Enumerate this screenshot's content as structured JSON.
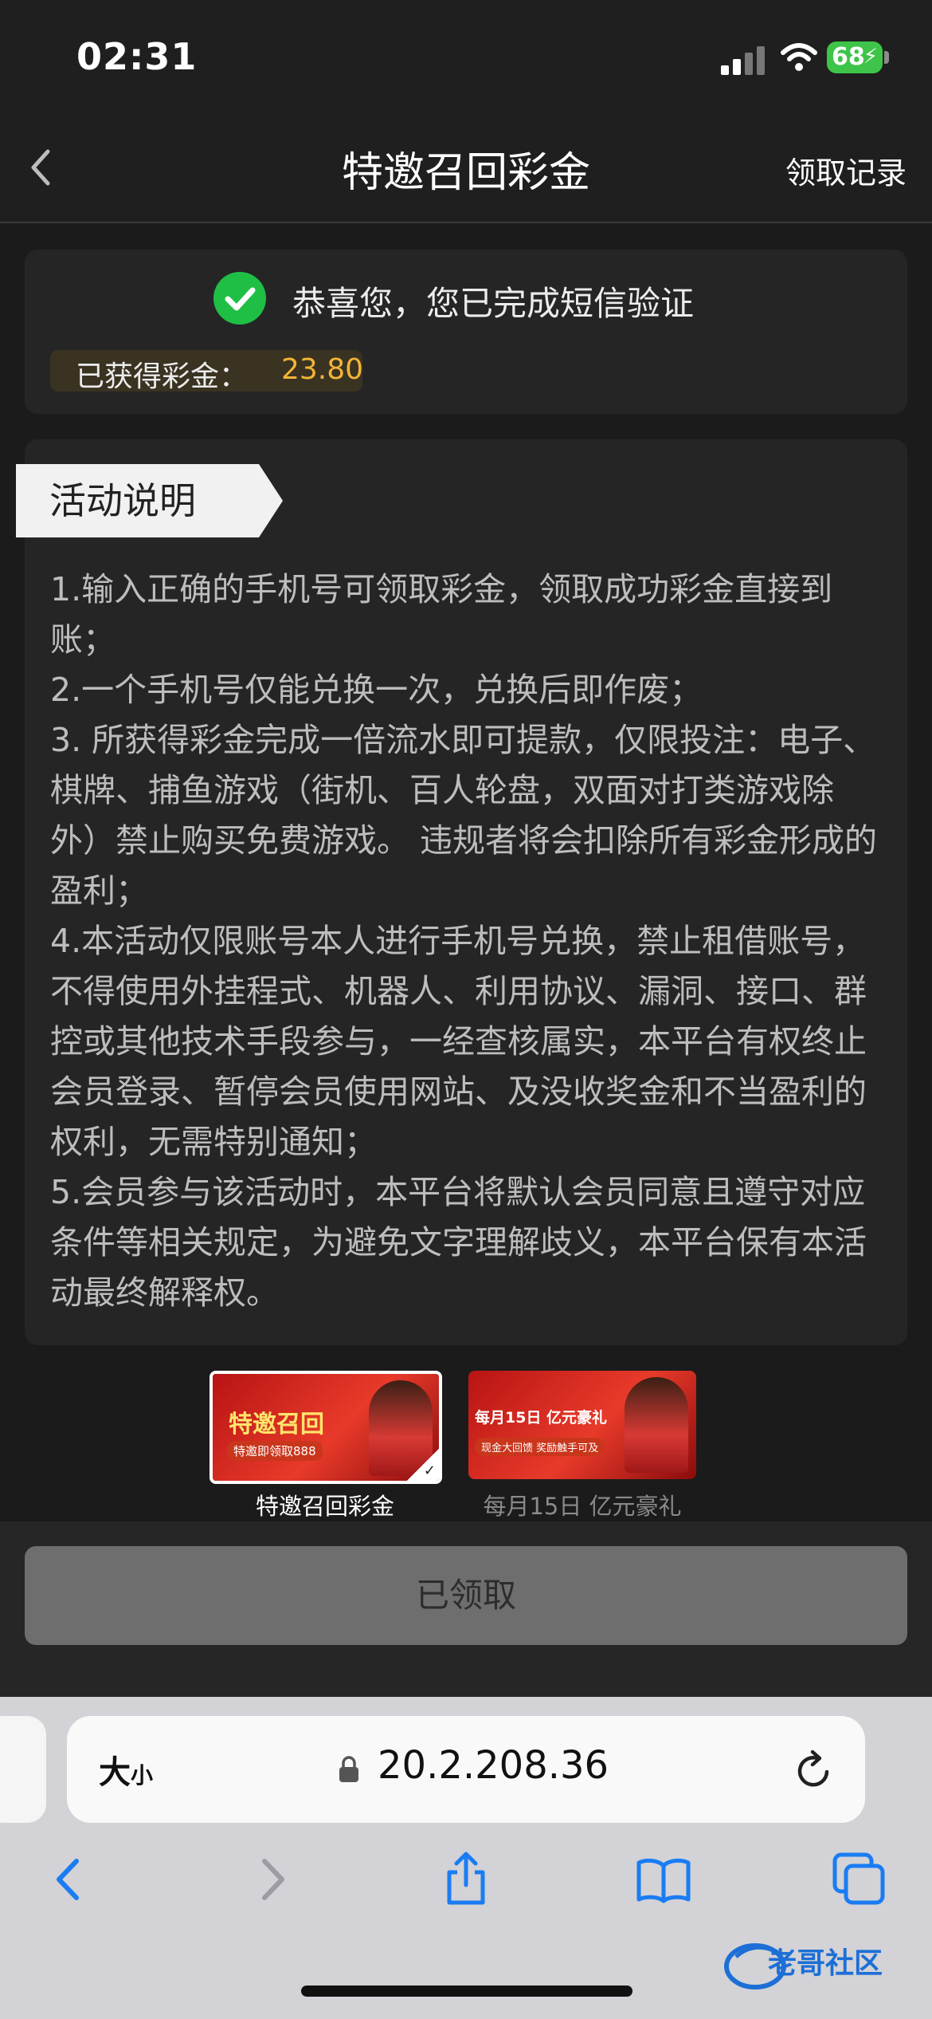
{
  "status_bar": {
    "time": "02:31",
    "battery": "68"
  },
  "nav": {
    "title": "特邀召回彩金",
    "records_link": "领取记录"
  },
  "success": {
    "message": "恭喜您，您已完成短信验证",
    "bonus_label": "已获得彩金：",
    "bonus_value": "23.80"
  },
  "description": {
    "tag": "活动说明",
    "text": "1.输入正确的手机号可领取彩金，领取成功彩金直接到账；\n2.一个手机号仅能兑换一次，兑换后即作废；\n3. 所获得彩金完成一倍流水即可提款，仅限投注：电子、棋牌、捕鱼游戏（街机、百人轮盘，双面对打类游戏除外）禁止购买免费游戏。 违规者将会扣除所有彩金形成的盈利；\n4.本活动仅限账号本人进行手机号兑换，禁止租借账号，不得使用外挂程式、机器人、利用协议、漏洞、接口、群控或其他技术手段参与，一经查核属实，本平台有权终止会员登录、暂停会员使用网站、及没收奖金和不当盈利的权利，无需特别通知；\n5.会员参与该活动时，本平台将默认会员同意且遵守对应条件等相关规定，为避免文字理解歧义，本平台保有本活动最终解释权。"
  },
  "promos": [
    {
      "label": "特邀召回彩金",
      "banner_title": "特邀召回",
      "banner_sub": "特邀即领取888",
      "selected": true
    },
    {
      "label": "每月15日 亿元豪礼",
      "banner_title": "每月15日 亿元豪礼",
      "banner_sub": "现金大回馈 奖励触手可及",
      "selected": false
    }
  ],
  "action": {
    "claimed_label": "已领取"
  },
  "browser": {
    "text_size_big": "大",
    "text_size_small": "小",
    "url": "20.2.208.36",
    "watermark": "老哥社区"
  },
  "colors": {
    "accent_gold": "#f2b438",
    "success_green": "#1fbf45",
    "battery_green": "#3dc449"
  },
  "icons": [
    "back-icon",
    "check-icon",
    "lock-icon",
    "reload-icon",
    "toolbar-back-icon",
    "toolbar-forward-icon",
    "share-icon",
    "bookmarks-icon",
    "tabs-icon"
  ]
}
